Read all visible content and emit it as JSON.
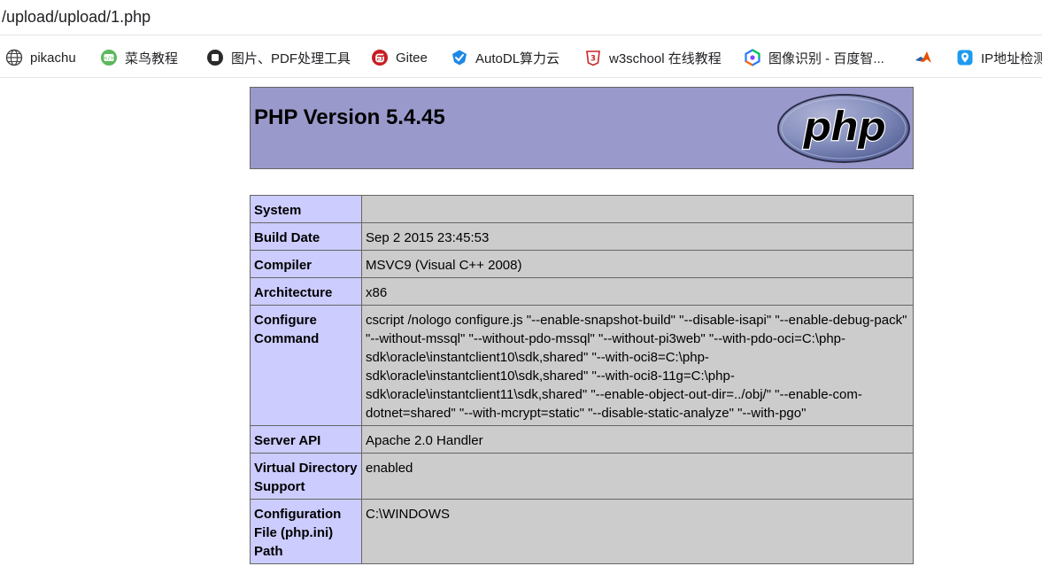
{
  "browser": {
    "url": "/upload/upload/1.php",
    "bookmarks": [
      {
        "label": "pikachu",
        "icon": "globe-icon"
      },
      {
        "label": "菜鸟教程",
        "icon": "runoob-icon"
      },
      {
        "label": "图片、PDF处理工具",
        "icon": "circle-square-icon"
      },
      {
        "label": "Gitee",
        "icon": "gitee-icon"
      },
      {
        "label": "AutoDL算力云",
        "icon": "autodl-icon"
      },
      {
        "label": "w3school 在线教程",
        "icon": "w3school-icon"
      },
      {
        "label": "图像识别 - 百度智...",
        "icon": "baidu-ai-icon"
      },
      {
        "label": "",
        "icon": "matlab-icon"
      },
      {
        "label": "IP地址检测",
        "icon": "ip-location-icon"
      }
    ]
  },
  "phpinfo": {
    "title": "PHP Version 5.4.45",
    "logo_text": "php",
    "colors": {
      "header_bg": "#9999cc",
      "label_bg": "#ccccff",
      "value_bg": "#cccccc",
      "border": "#666666"
    },
    "rows": [
      {
        "label": "System",
        "value": ""
      },
      {
        "label": "Build Date",
        "value": "Sep 2 2015 23:45:53"
      },
      {
        "label": "Compiler",
        "value": "MSVC9 (Visual C++ 2008)"
      },
      {
        "label": "Architecture",
        "value": "x86"
      },
      {
        "label": "Configure Command",
        "value": "cscript /nologo configure.js \"--enable-snapshot-build\" \"--disable-isapi\" \"--enable-debug-pack\" \"--without-mssql\" \"--without-pdo-mssql\" \"--without-pi3web\" \"--with-pdo-oci=C:\\php-sdk\\oracle\\instantclient10\\sdk,shared\" \"--with-oci8=C:\\php-sdk\\oracle\\instantclient10\\sdk,shared\" \"--with-oci8-11g=C:\\php-sdk\\oracle\\instantclient11\\sdk,shared\" \"--enable-object-out-dir=../obj/\" \"--enable-com-dotnet=shared\" \"--with-mcrypt=static\" \"--disable-static-analyze\" \"--with-pgo\""
      },
      {
        "label": "Server API",
        "value": "Apache 2.0 Handler"
      },
      {
        "label": "Virtual Directory Support",
        "value": "enabled"
      },
      {
        "label": "Configuration File (php.ini) Path",
        "value": "C:\\WINDOWS"
      }
    ]
  }
}
